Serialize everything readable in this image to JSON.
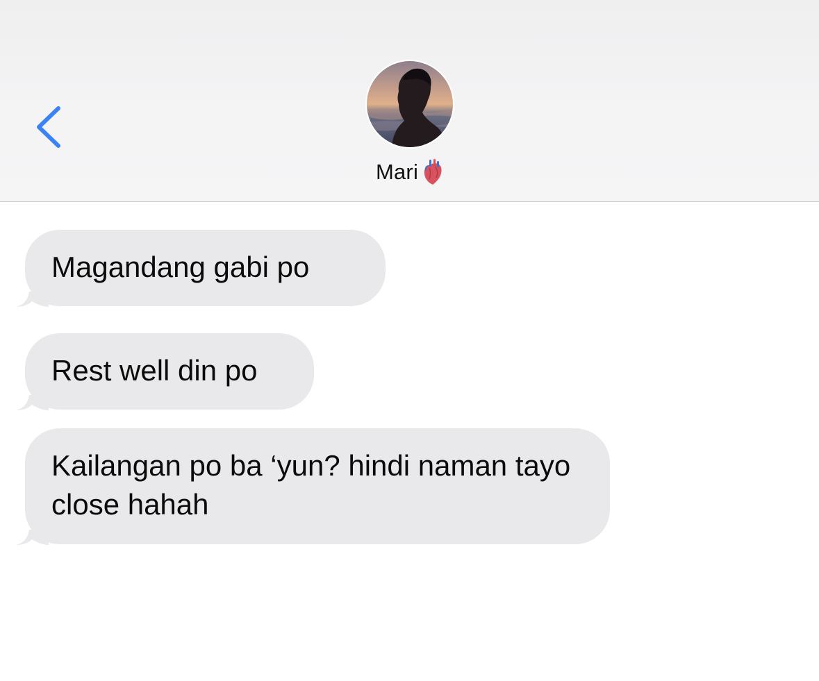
{
  "header": {
    "contact_name": "Mari",
    "name_emoji": "anatomical-heart",
    "back_icon": "chevron-left-icon"
  },
  "colors": {
    "accent": "#3a82f6",
    "bubble_incoming": "#e9e9eb",
    "header_bg": "#f2f2f3"
  },
  "messages": [
    {
      "direction": "incoming",
      "text": "Magandang gabi po"
    },
    {
      "direction": "incoming",
      "text": "Rest well din po"
    },
    {
      "direction": "incoming",
      "text": "Kailangan po ba ‘yun? hindi naman tayo close hahah"
    }
  ]
}
